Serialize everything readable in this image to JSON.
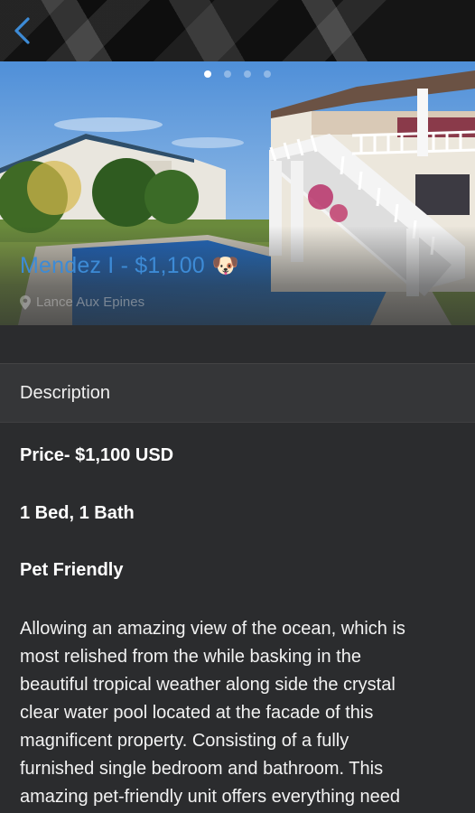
{
  "header": {
    "back_icon": "chevron-left-icon"
  },
  "listing": {
    "title": "Mendez I - $1,100",
    "title_emoji": "🐶",
    "location": "Lance Aux Epines",
    "carousel": {
      "total": 4,
      "active_index": 0
    }
  },
  "description": {
    "heading": "Description",
    "price_line": "Price- $1,100 USD",
    "rooms_line": "1 Bed, 1 Bath",
    "pet_line": "Pet Friendly",
    "body_lines": [
      "Allowing an amazing view of the ocean, which is",
      "most relished from the while basking in the",
      "beautiful tropical weather along side the crystal",
      "clear water pool located at the facade of this",
      "magnificent property. Consisting of a fully",
      "furnished single bedroom and bathroom. This",
      "amazing pet-friendly unit offers everything need"
    ]
  },
  "colors": {
    "accent": "#3d8bd6",
    "background": "#2b2c2e",
    "section": "#353638"
  }
}
